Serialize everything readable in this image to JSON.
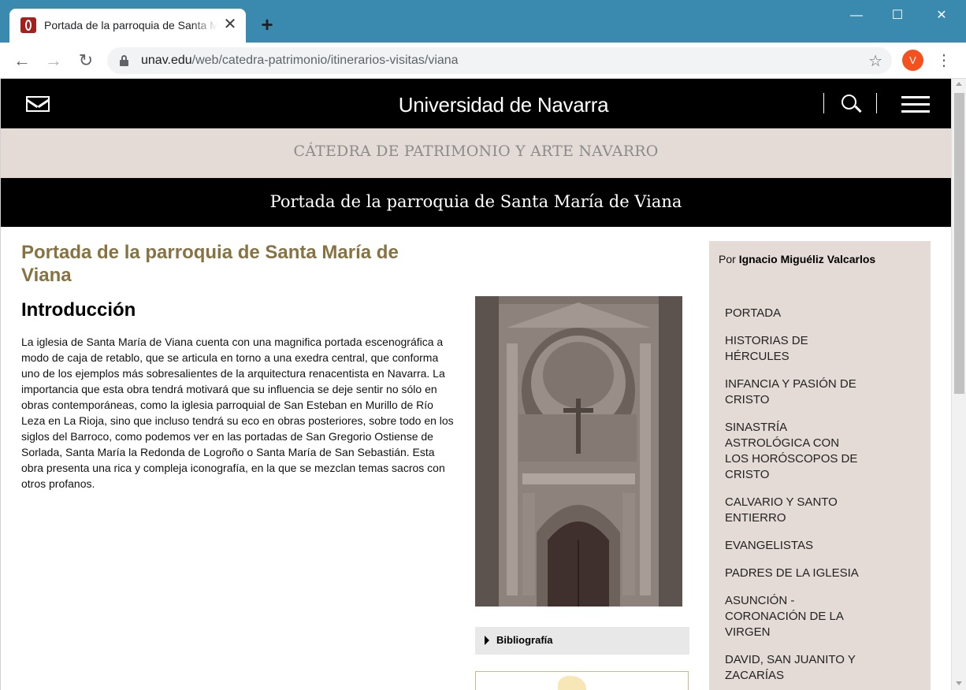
{
  "browser": {
    "tab_title": "Portada de la parroquia de Santa María de Viana",
    "tab_close": "✕",
    "new_tab": "+",
    "window_minimize": "—",
    "window_maximize": "☐",
    "window_close": "✕",
    "back": "←",
    "forward": "→",
    "reload": "↻",
    "url_host": "unav.edu",
    "url_path": "/web/catedra-patrimonio/itinerarios-visitas/viana",
    "bookmark": "☆",
    "profile_initial": "V",
    "menu": "⋮"
  },
  "site": {
    "logo": "Universidad de Navarra",
    "subtitle": "CÁTEDRA DE PATRIMONIO Y ARTE NAVARRO",
    "page_banner": "Portada de la parroquia de Santa María de Viana"
  },
  "article": {
    "title": "Portada de la parroquia de Santa María de Viana",
    "intro_heading": "Introducción",
    "intro_text": "La iglesia de Santa María de Viana cuenta con una magnifica portada escenográfica a modo de caja de retablo, que se articula en torno a una exedra central, que conforma uno de los ejemplos más sobresalientes de la arquitectura renacentista en Navarra. La importancia que esta obra tendrá motivará que su influencia se deje sentir no sólo en obras contemporáneas, como la iglesia parroquial de San Esteban en Murillo de Río Leza en La Rioja, sino que incluso tendrá su eco en obras posteriores, sobre todo en los siglos del Barroco, como podemos ver en las portadas de San Gregorio Ostiense de Sorlada, Santa María la Redonda de Logroño o Santa María de San Sebastián. Esta obra presenta una rica y compleja iconografía, en la que se mezclan temas sacros con otros profanos.",
    "bibliography_label": "Bibliografía"
  },
  "sidebar": {
    "author_prefix": "Por ",
    "author_name": "Ignacio Miguéliz Valcarlos",
    "items": [
      {
        "label": "PORTADA"
      },
      {
        "label": "HISTORIAS DE HÉRCULES"
      },
      {
        "label": "INFANCIA Y PASIÓN DE CRISTO"
      },
      {
        "label": "SINASTRÍA ASTROLÓGICA CON LOS HORÓSCOPOS DE CRISTO"
      },
      {
        "label": "CALVARIO Y SANTO ENTIERRO"
      },
      {
        "label": "EVANGELISTAS"
      },
      {
        "label": "PADRES DE LA IGLESIA"
      },
      {
        "label": "ASUNCIÓN - CORONACIÓN DE LA VIRGEN"
      },
      {
        "label": "DAVID, SAN JUANITO Y ZACARÍAS"
      }
    ]
  },
  "colors": {
    "title_gold": "#877342",
    "sidebar_bg": "#e5dbd6",
    "header_bg": "#000000",
    "chrome_blue": "#3a8ab0"
  }
}
